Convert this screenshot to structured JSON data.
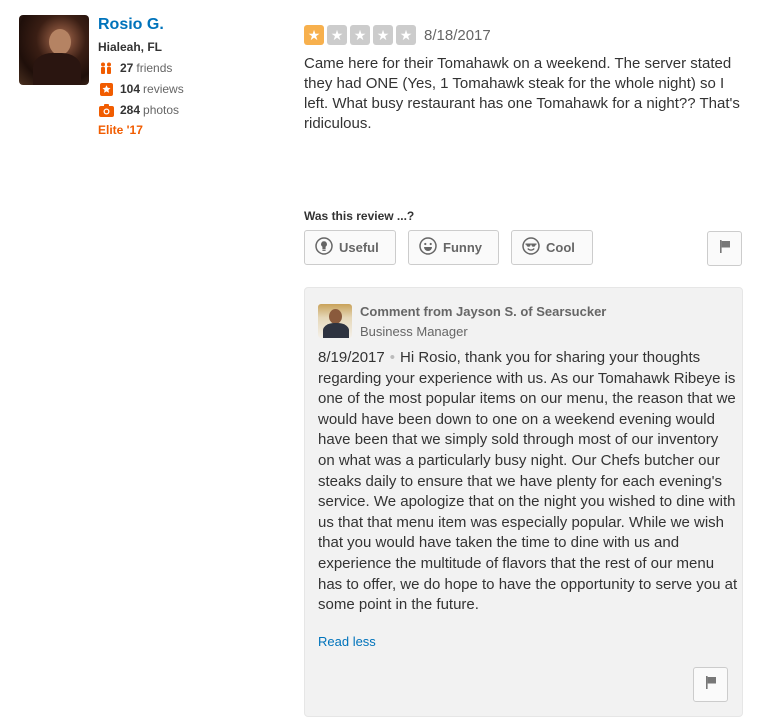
{
  "user": {
    "name": "Rosio G.",
    "location": "Hialeah, FL",
    "friends_count": "27",
    "friends_label": "friends",
    "reviews_count": "104",
    "reviews_label": "reviews",
    "photos_count": "284",
    "photos_label": "photos",
    "elite": "Elite '17"
  },
  "review": {
    "rating": 1,
    "max_rating": 5,
    "date": "8/18/2017",
    "text": "Came here for their Tomahawk on a weekend. The server stated they had ONE (Yes, 1 Tomahawk steak for the whole night) so I left. What busy restaurant has one Tomahawk for a night?? That's ridiculous."
  },
  "feedback": {
    "prompt": "Was this review ...?",
    "useful_label": "Useful",
    "funny_label": "Funny",
    "cool_label": "Cool"
  },
  "business_comment": {
    "from": "Comment from Jayson S. of Searsucker",
    "role": "Business Manager",
    "date": "8/19/2017",
    "separator": "•",
    "text": "Hi Rosio, thank you for sharing your thoughts regarding your experience with us.  As our Tomahawk Ribeye is one of the most popular items on our menu, the reason that we would have been down to one on a weekend evening would have been that we simply sold through most of our inventory on what was a particularly busy night.  Our Chefs butcher our steaks daily to ensure that we have plenty for each evening's service. We apologize that on the night you wished to dine with us that that menu item was especially popular.  While we wish that you would have taken the time to dine with us and experience the multitude of flavors that the rest of our menu has to offer, we do hope to have the opportunity to serve you at some point in the future.",
    "read_less": "Read less"
  },
  "colors": {
    "link": "#0073bb",
    "elite": "#f15c00",
    "star_on": "#f7b04d",
    "star_off": "#cccccc",
    "reviews_icon": "#f15c00"
  },
  "icons": [
    "friends-icon",
    "reviews-star-icon",
    "camera-icon",
    "star-icon",
    "useful-icon",
    "funny-icon",
    "cool-icon",
    "flag-icon"
  ]
}
